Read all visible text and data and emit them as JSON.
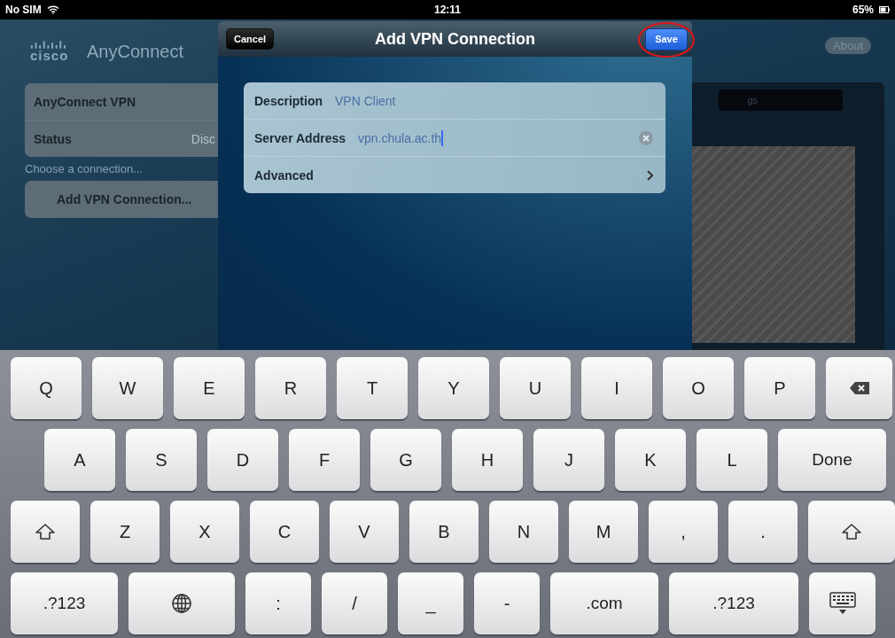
{
  "status_bar": {
    "carrier": "No SIM",
    "time": "12:11",
    "battery": "65%"
  },
  "app": {
    "logo": "cisco",
    "title": "AnyConnect",
    "about_button": "About",
    "vpn_table": [
      {
        "label": "AnyConnect VPN"
      },
      {
        "label": "Status",
        "value": "Disc"
      }
    ],
    "choose_hint": "Choose a connection...",
    "add_button": "Add VPN Connection...",
    "tab_label": "gs"
  },
  "dialog": {
    "title": "Add VPN Connection",
    "cancel": "Cancel",
    "save": {
      "label": "Save",
      "highlighted": true
    },
    "fields": [
      {
        "kind": "text",
        "label": "Description",
        "value": "VPN Client",
        "focused": false
      },
      {
        "kind": "text",
        "label": "Server Address",
        "value": "vpn.chula.ac.th",
        "focused": true
      },
      {
        "kind": "link",
        "label": "Advanced"
      }
    ]
  },
  "keyboard": [
    [
      {
        "kind": "char",
        "label": "Q"
      },
      {
        "kind": "char",
        "label": "W"
      },
      {
        "kind": "char",
        "label": "E"
      },
      {
        "kind": "char",
        "label": "R"
      },
      {
        "kind": "char",
        "label": "T"
      },
      {
        "kind": "char",
        "label": "Y"
      },
      {
        "kind": "char",
        "label": "U"
      },
      {
        "kind": "char",
        "label": "I"
      },
      {
        "kind": "char",
        "label": "O"
      },
      {
        "kind": "char",
        "label": "P"
      },
      {
        "kind": "backspace"
      }
    ],
    [
      {
        "kind": "char",
        "label": "A"
      },
      {
        "kind": "char",
        "label": "S"
      },
      {
        "kind": "char",
        "label": "D"
      },
      {
        "kind": "char",
        "label": "F"
      },
      {
        "kind": "char",
        "label": "G"
      },
      {
        "kind": "char",
        "label": "H"
      },
      {
        "kind": "char",
        "label": "J"
      },
      {
        "kind": "char",
        "label": "K"
      },
      {
        "kind": "char",
        "label": "L"
      },
      {
        "kind": "done",
        "label": "Done"
      }
    ],
    [
      {
        "kind": "shift"
      },
      {
        "kind": "char",
        "label": "Z"
      },
      {
        "kind": "char",
        "label": "X"
      },
      {
        "kind": "char",
        "label": "C"
      },
      {
        "kind": "char",
        "label": "V"
      },
      {
        "kind": "char",
        "label": "B"
      },
      {
        "kind": "char",
        "label": "N"
      },
      {
        "kind": "char",
        "label": "M"
      },
      {
        "kind": "char",
        "label": ","
      },
      {
        "kind": "char",
        "label": "."
      },
      {
        "kind": "shift"
      }
    ],
    [
      {
        "kind": "numbers",
        "label": ".?123"
      },
      {
        "kind": "globe"
      },
      {
        "kind": "char",
        "label": ":"
      },
      {
        "kind": "char",
        "label": "/"
      },
      {
        "kind": "char",
        "label": "_"
      },
      {
        "kind": "char",
        "label": "-"
      },
      {
        "kind": "dotcom",
        "label": ".com"
      },
      {
        "kind": "numbers",
        "label": ".?123"
      },
      {
        "kind": "hide"
      }
    ]
  ]
}
